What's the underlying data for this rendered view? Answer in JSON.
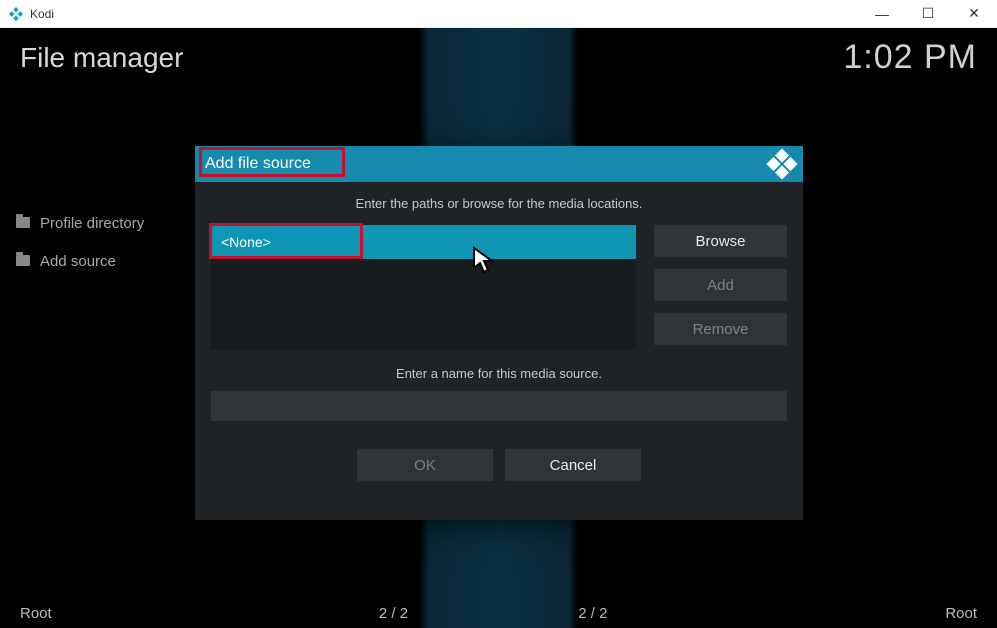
{
  "window": {
    "title": "Kodi"
  },
  "header": {
    "title": "File manager",
    "clock": "1:02 PM"
  },
  "sidebar": {
    "items": [
      {
        "label": "Profile directory"
      },
      {
        "label": "Add source"
      }
    ]
  },
  "status": {
    "left": "Root",
    "center1": "2 / 2",
    "center2": "2 / 2",
    "right": "Root"
  },
  "dialog": {
    "title": "Add file source",
    "hint_paths": "Enter the paths or browse for the media locations.",
    "path_value": "<None>",
    "browse": "Browse",
    "add": "Add",
    "remove": "Remove",
    "hint_name": "Enter a name for this media source.",
    "name_value": "",
    "ok": "OK",
    "cancel": "Cancel"
  },
  "icons": {
    "minimize": "—",
    "maximize": "☐",
    "close": "✕"
  }
}
